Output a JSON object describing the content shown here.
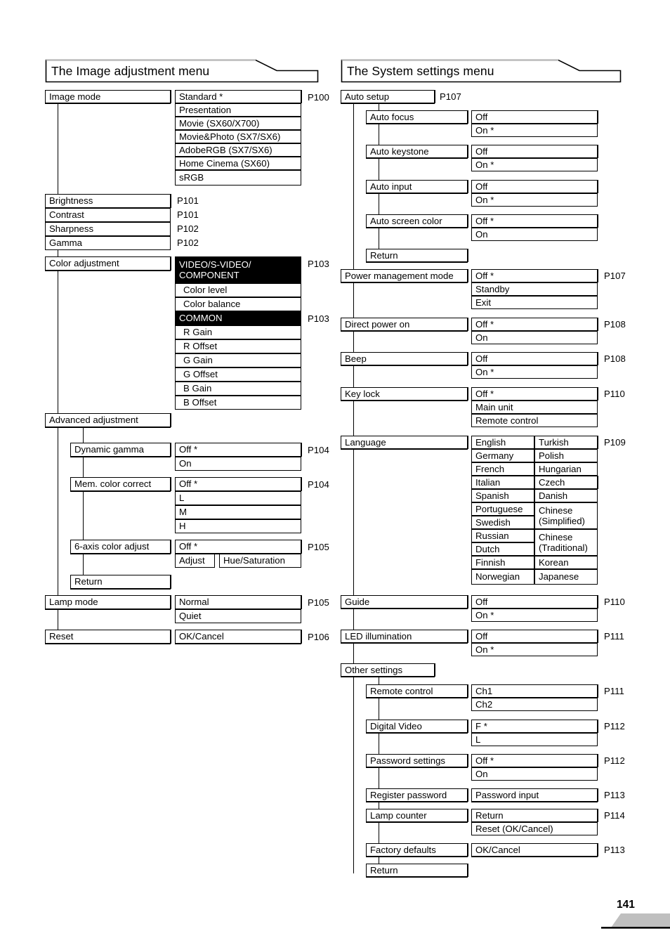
{
  "page": {
    "number": "141"
  },
  "columns": [
    {
      "heading": "The Image adjustment menu",
      "groups": [
        {
          "name": "Image mode",
          "page": "P100",
          "options": [
            "Standard *",
            "Presentation",
            "Movie (SX60/X700)",
            "Movie&Photo (SX7/SX6)",
            "AdobeRGB (SX7/SX6)",
            "Home Cinema (SX60)",
            "sRGB"
          ]
        },
        {
          "name": "Brightness",
          "page": "P101",
          "options": []
        },
        {
          "name": "Contrast",
          "page": "P101",
          "options": []
        },
        {
          "name": "Sharpness",
          "page": "P102",
          "options": []
        },
        {
          "name": "Gamma",
          "page": "P102",
          "options": []
        },
        {
          "name": "Color adjustment",
          "page": "P103",
          "options": [
            "VIDEO/S-VIDEO/ COMPONENT",
            "Color level",
            "Color balance",
            "COMMON",
            "R Gain",
            "R Offset",
            "G Gain",
            "G Offset",
            "B Gain",
            "B Offset"
          ],
          "page2": "P103"
        },
        {
          "name": "Advanced adjustment",
          "page": "",
          "options": []
        },
        {
          "name": "Dynamic gamma",
          "page": "P104",
          "options": [
            "Off *",
            "On"
          ]
        },
        {
          "name": "Mem. color correct",
          "page": "P104",
          "options": [
            "Off *",
            "L",
            "M",
            "H"
          ]
        },
        {
          "name": "6-axis color adjust",
          "page": "P105",
          "options": [
            "Off *",
            "Adjust",
            "Hue/Saturation"
          ]
        },
        {
          "name": "Return",
          "page": "",
          "options": []
        },
        {
          "name": "Lamp mode",
          "page": "P105",
          "options": [
            "Normal",
            "Quiet"
          ]
        },
        {
          "name": "Reset",
          "page": "P106",
          "options": [
            "OK/Cancel"
          ]
        }
      ]
    },
    {
      "heading": "The System settings menu",
      "groups": [
        {
          "name": "Auto setup",
          "page": "P107",
          "options": []
        },
        {
          "name": "Auto focus",
          "page": "",
          "options": [
            "Off",
            "On *"
          ]
        },
        {
          "name": "Auto keystone",
          "page": "",
          "options": [
            "Off",
            "On *"
          ]
        },
        {
          "name": "Auto input",
          "page": "",
          "options": [
            "Off",
            "On *"
          ]
        },
        {
          "name": "Auto screen color",
          "page": "",
          "options": [
            "Off *",
            "On"
          ]
        },
        {
          "name": "Return",
          "page": "",
          "options": []
        },
        {
          "name": "Power management mode",
          "page": "P107",
          "options": [
            "Off *",
            "Standby",
            "Exit"
          ]
        },
        {
          "name": "Direct power on",
          "page": "P108",
          "options": [
            "Off *",
            "On"
          ]
        },
        {
          "name": "Beep",
          "page": "P108",
          "options": [
            "Off",
            "On *"
          ]
        },
        {
          "name": "Key lock",
          "page": "P110",
          "options": [
            "Off *",
            "Main unit",
            "Remote control"
          ]
        },
        {
          "name": "Language",
          "page": "P109",
          "left": [
            "English",
            "Germany",
            "French",
            "Italian",
            "Spanish",
            "Portuguese",
            "Swedish",
            "Russian",
            "Dutch",
            "Finnish",
            "Norwegian"
          ],
          "right": [
            "Turkish",
            "Polish",
            "Hungarian",
            "Czech",
            "Danish",
            "Chinese (Simplified)",
            "Chinese (Traditional)",
            "Korean",
            "Japanese"
          ]
        },
        {
          "name": "Guide",
          "page": "P110",
          "options": [
            "Off",
            "On *"
          ]
        },
        {
          "name": "LED illumination",
          "page": "P111",
          "options": [
            "Off",
            "On *"
          ]
        },
        {
          "name": "Other settings",
          "page": "",
          "options": []
        },
        {
          "name": "Remote control",
          "page": "P111",
          "options": [
            "Ch1",
            "Ch2"
          ]
        },
        {
          "name": "Digital Video",
          "page": "P112",
          "options": [
            "F *",
            "L"
          ]
        },
        {
          "name": "Password settings",
          "page": "P112",
          "options": [
            "Off *",
            "On"
          ]
        },
        {
          "name": "Register password",
          "page": "P113",
          "options": [
            "Password input"
          ]
        },
        {
          "name": "Lamp counter",
          "page": "P114",
          "options": [
            "Return",
            "Reset (OK/Cancel)"
          ]
        },
        {
          "name": "Factory defaults",
          "page": "P113",
          "options": [
            "OK/Cancel"
          ]
        },
        {
          "name": "Return",
          "page": "",
          "options": []
        }
      ]
    }
  ],
  "labels": {
    "L": {
      "heading": "The Image adjustment menu",
      "image_mode": "Image mode",
      "opt_standard": "Standard *",
      "opt_presentation": "Presentation",
      "opt_movie": "Movie (SX60/X700)",
      "opt_moviephoto": "Movie&Photo (SX7/SX6)",
      "opt_adobergb": "AdobeRGB (SX7/SX6)",
      "opt_homecinema": "Home Cinema (SX60)",
      "opt_srgb": "sRGB",
      "p100": "P100",
      "brightness": "Brightness",
      "contrast": "Contrast",
      "sharpness": "Sharpness",
      "gamma": "Gamma",
      "p101a": "P101",
      "p101b": "P101",
      "p102a": "P102",
      "p102b": "P102",
      "color_adjustment": "Color adjustment",
      "vid_line1": "VIDEO/S-VIDEO/",
      "vid_line2": "COMPONENT",
      "color_level": "Color level",
      "color_balance": "Color balance",
      "common": "COMMON",
      "r_gain": "R Gain",
      "r_offset": "R Offset",
      "g_gain": "G Gain",
      "g_offset": "G Offset",
      "b_gain": "B Gain",
      "b_offset": "B Offset",
      "p103a": "P103",
      "p103b": "P103",
      "advanced_adjustment": "Advanced adjustment",
      "dynamic_gamma": "Dynamic gamma",
      "dg_off": "Off *",
      "dg_on": "On",
      "p104a": "P104",
      "mem_color": "Mem. color correct",
      "mc_off": "Off *",
      "mc_l": "L",
      "mc_m": "M",
      "mc_h": "H",
      "p104b": "P104",
      "six_axis": "6-axis color adjust",
      "sa_off": "Off *",
      "sa_adjust": "Adjust",
      "sa_hue": "Hue/Saturation",
      "p105a": "P105",
      "return1": "Return",
      "lamp_mode": "Lamp mode",
      "lm_normal": "Normal",
      "lm_quiet": "Quiet",
      "p105b": "P105",
      "reset": "Reset",
      "rs_okcancel": "OK/Cancel",
      "p106": "P106"
    },
    "R": {
      "heading": "The System settings menu",
      "auto_setup": "Auto setup",
      "p107a": "P107",
      "auto_focus": "Auto focus",
      "af_off": "Off",
      "af_on": "On *",
      "auto_keystone": "Auto keystone",
      "ak_off": "Off",
      "ak_on": "On *",
      "auto_input": "Auto input",
      "ai_off": "Off",
      "ai_on": "On *",
      "auto_screen": "Auto screen color",
      "as_off": "Off *",
      "as_on": "On",
      "return_auto": "Return",
      "power_mgmt": "Power management mode",
      "pm_off": "Off *",
      "pm_standby": "Standby",
      "pm_exit": "Exit",
      "p107b": "P107",
      "direct_power": "Direct power on",
      "dp_off": "Off *",
      "dp_on": "On",
      "p108a": "P108",
      "beep": "Beep",
      "bp_off": "Off",
      "bp_on": "On *",
      "p108b": "P108",
      "key_lock": "Key lock",
      "kl_off": "Off *",
      "kl_main": "Main unit",
      "kl_remote": "Remote control",
      "p110a": "P110",
      "language": "Language",
      "p109": "P109",
      "lang_english": "English",
      "lang_germany": "Germany",
      "lang_french": "French",
      "lang_italian": "Italian",
      "lang_spanish": "Spanish",
      "lang_portuguese": "Portuguese",
      "lang_swedish": "Swedish",
      "lang_russian": "Russian",
      "lang_dutch": "Dutch",
      "lang_finnish": "Finnish",
      "lang_norwegian": "Norwegian",
      "lang_turkish": "Turkish",
      "lang_polish": "Polish",
      "lang_hungarian": "Hungarian",
      "lang_czech": "Czech",
      "lang_danish": "Danish",
      "lang_chinese_s1": "Chinese",
      "lang_chinese_s2": "(Simplified)",
      "lang_chinese_t1": "Chinese",
      "lang_chinese_t2": "(Traditional)",
      "lang_korean": "Korean",
      "lang_japanese": "Japanese",
      "guide": "Guide",
      "gd_off": "Off",
      "gd_on": "On *",
      "p110b": "P110",
      "led": "LED illumination",
      "led_off": "Off",
      "led_on": "On *",
      "p111a": "P111",
      "other_settings": "Other settings",
      "remote_control": "Remote control",
      "rc_ch1": "Ch1",
      "rc_ch2": "Ch2",
      "p111b": "P111",
      "digital_video": "Digital Video",
      "dv_f": "F *",
      "dv_l": "L",
      "p112a": "P112",
      "password_settings": "Password settings",
      "ps_off": "Off *",
      "ps_on": "On",
      "p112b": "P112",
      "register_password": "Register password",
      "rp_input": "Password input",
      "p113a": "P113",
      "lamp_counter": "Lamp counter",
      "lc_return": "Return",
      "lc_reset": "Reset (OK/Cancel)",
      "p114": "P114",
      "factory_defaults": "Factory defaults",
      "fd_okcancel": "OK/Cancel",
      "p113b": "P113",
      "return_other": "Return"
    }
  }
}
